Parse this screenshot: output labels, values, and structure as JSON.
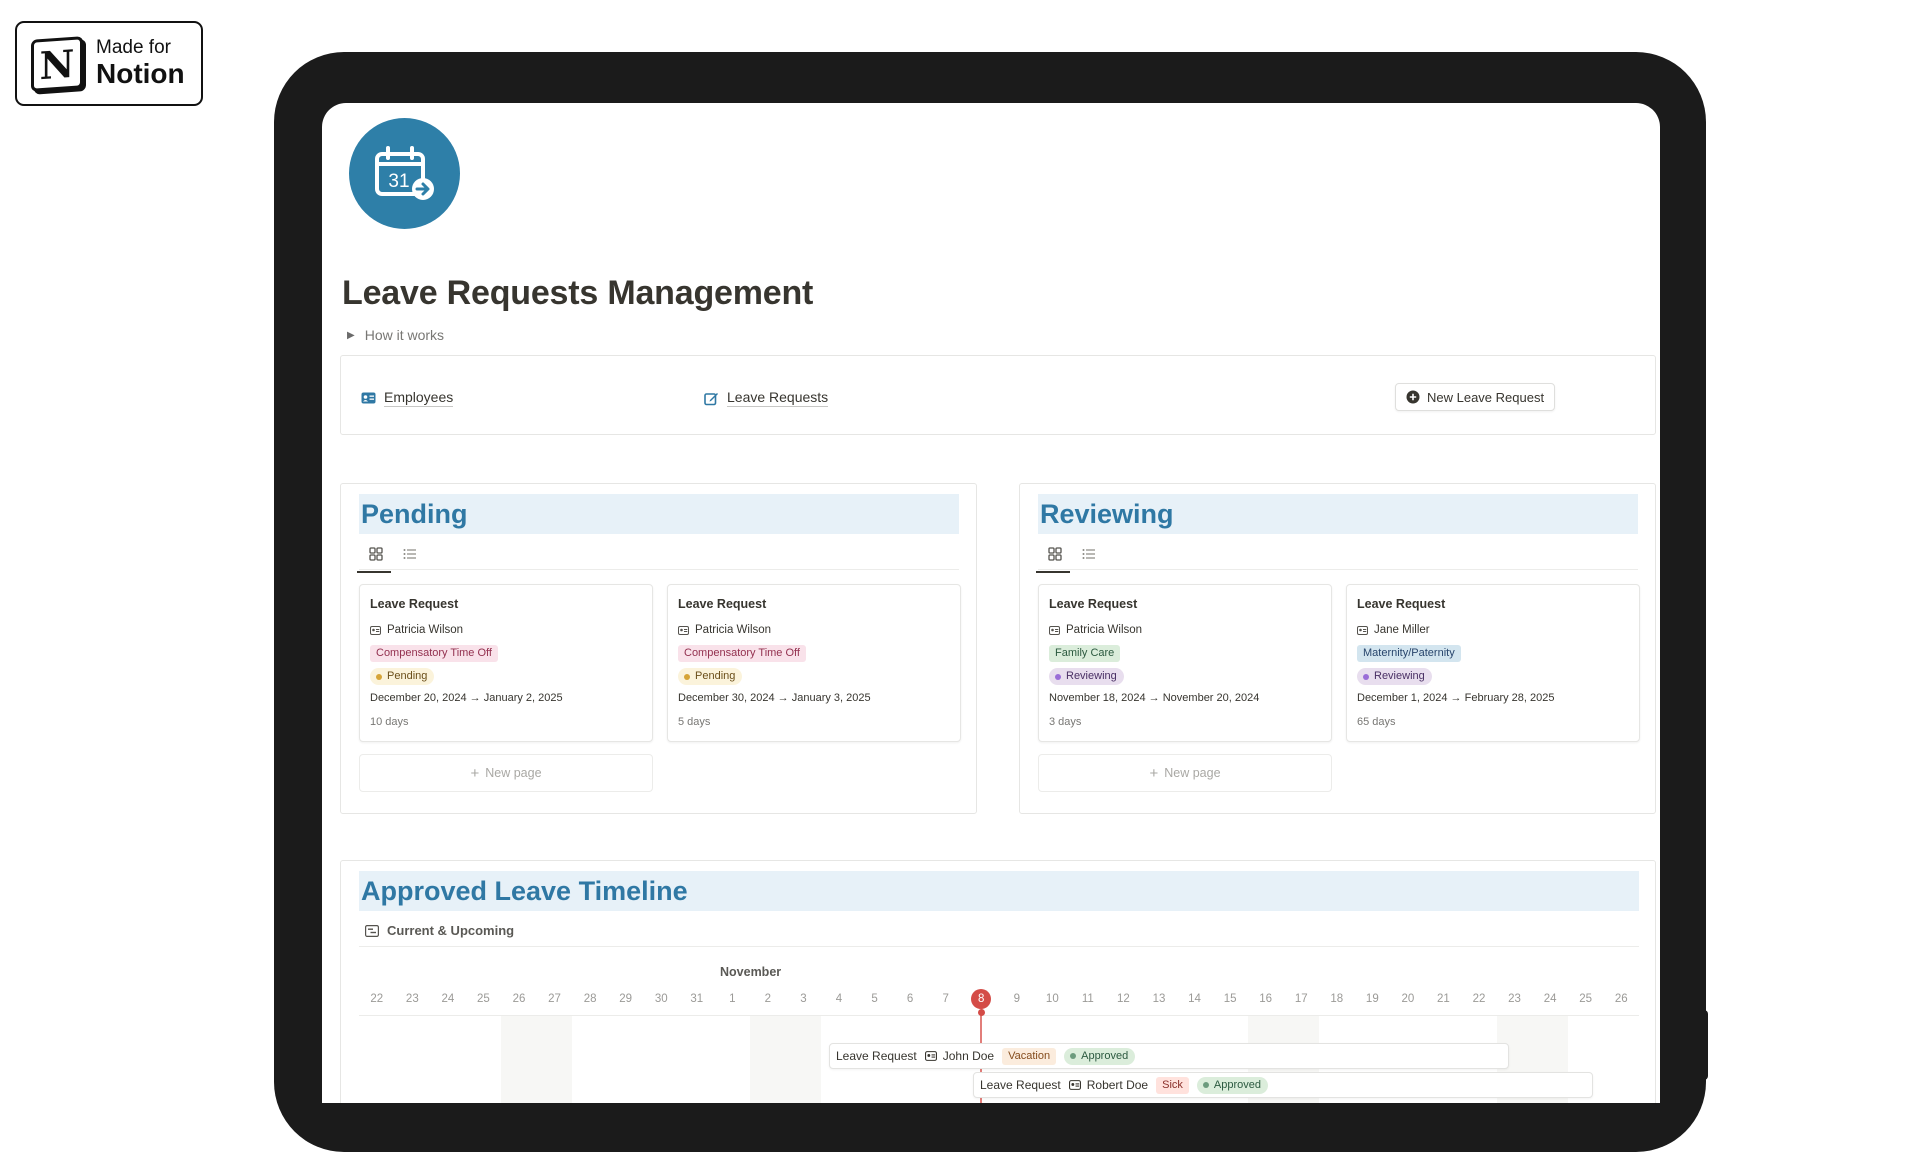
{
  "badge": {
    "line1": "Made for",
    "line2": "Notion",
    "logo_letter": "N"
  },
  "page": {
    "icon": "calendar-arrow-icon",
    "icon_number": "31",
    "icon_color": "#2e7fa8",
    "title": "Leave Requests Management",
    "toggle_label": "How it works"
  },
  "links": {
    "employees": "Employees",
    "leave_requests": "Leave Requests",
    "new_request": "New Leave Request"
  },
  "pending": {
    "heading": "Pending",
    "new_page": "New page",
    "cards": [
      {
        "title": "Leave Request",
        "employee": "Patricia Wilson",
        "type": "Compensatory Time Off",
        "status": "Pending",
        "dates": "December 20, 2024 → January 2, 2025",
        "days": "10 days"
      },
      {
        "title": "Leave Request",
        "employee": "Patricia Wilson",
        "type": "Compensatory Time Off",
        "status": "Pending",
        "dates": "December 30, 2024 → January 3, 2025",
        "days": "5 days"
      }
    ]
  },
  "reviewing": {
    "heading": "Reviewing",
    "new_page": "New page",
    "cards": [
      {
        "title": "Leave Request",
        "employee": "Patricia Wilson",
        "type": "Family Care",
        "status": "Reviewing",
        "dates": "November 18, 2024 → November 20, 2024",
        "days": "3 days"
      },
      {
        "title": "Leave Request",
        "employee": "Jane Miller",
        "type": "Maternity/Paternity",
        "status": "Reviewing",
        "dates": "December 1, 2024 → February 28, 2025",
        "days": "65 days"
      }
    ]
  },
  "timeline": {
    "heading": "Approved Leave Timeline",
    "view_name": "Current & Upcoming",
    "month": "November",
    "days": [
      "22",
      "23",
      "24",
      "25",
      "26",
      "27",
      "28",
      "29",
      "30",
      "31",
      "1",
      "2",
      "3",
      "4",
      "5",
      "6",
      "7",
      "8",
      "9",
      "10",
      "11",
      "12",
      "13",
      "14",
      "15",
      "16",
      "17",
      "18",
      "19",
      "20",
      "21",
      "22",
      "23",
      "24",
      "25",
      "26"
    ],
    "today": "8",
    "entries": [
      {
        "title": "Leave Request",
        "employee": "John Doe",
        "type": "Vacation",
        "status": "Approved"
      },
      {
        "title": "Leave Request",
        "employee": "Robert Doe",
        "type": "Sick",
        "status": "Approved"
      }
    ]
  },
  "colors": {
    "heading_bg": "#e7f1f8",
    "heading_text": "#2f78a4",
    "tag_pink_bg": "#f9e2ea",
    "tag_pink_text": "#93304f",
    "tag_green_bg": "#dbeddb",
    "tag_green_text": "#2b593f",
    "tag_blue_bg": "#d3e5ef",
    "tag_blue_text": "#28456c",
    "status_pending_bg": "#fbf3db",
    "status_reviewing_bg": "#e8deee",
    "tag_vacation_bg": "#fbecdd",
    "tag_sick_bg": "#ffe2dd",
    "today": "#d44c47"
  }
}
